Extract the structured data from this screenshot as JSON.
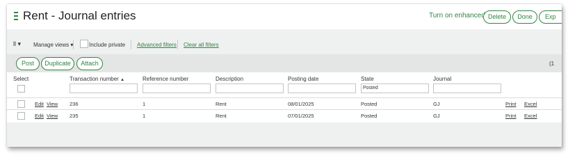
{
  "title": "Rent - Journal entries",
  "top_actions": {
    "enhanced_list": "Turn on enhanced list",
    "delete": "Delete",
    "done": "Done",
    "export": "Exp"
  },
  "toolbar": {
    "views_toggle": "ll ▾",
    "manage_views": "Manage views ▾",
    "include_private": "Include private",
    "advanced_filters": "Advanced filters",
    "clear_all_filters": "Clear all filters"
  },
  "action_bar": {
    "post": "Post",
    "duplicate": "Duplicate",
    "attach": "Attach",
    "count": "(1"
  },
  "columns": {
    "select": "Select",
    "transaction_number": "Transaction number",
    "sort_indicator": "▲",
    "reference_number": "Reference number",
    "description": "Description",
    "posting_date": "Posting date",
    "state": "State",
    "journal": "Journal"
  },
  "filters": {
    "state": "Posted"
  },
  "rows": [
    {
      "edit": "Edit",
      "view": "View",
      "transaction_number": "236",
      "reference_number": "1",
      "description": "Rent",
      "posting_date": "08/01/2025",
      "state": "Posted",
      "journal": "GJ",
      "print": "Print",
      "excel": "Excel"
    },
    {
      "edit": "Edit",
      "view": "View",
      "transaction_number": "235",
      "reference_number": "1",
      "description": "Rent",
      "posting_date": "07/01/2025",
      "state": "Posted",
      "journal": "GJ",
      "print": "Print",
      "excel": "Excel"
    }
  ],
  "colors": {
    "accent": "#2e8540",
    "panel": "#eff1f1",
    "action_bar": "#e4e6e6"
  }
}
